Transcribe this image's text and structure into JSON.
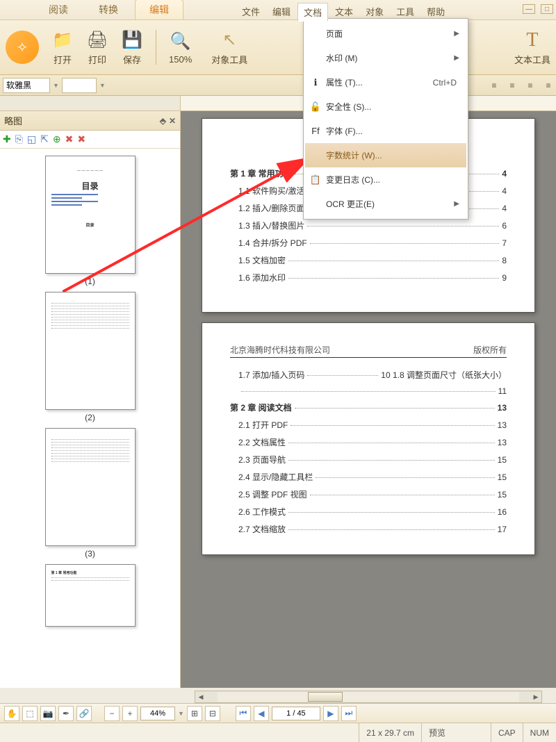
{
  "tabs": [
    "阅读",
    "转换",
    "编辑"
  ],
  "menus": [
    "文件",
    "编辑",
    "文档",
    "文本",
    "对象",
    "工具",
    "帮助"
  ],
  "ribbon": {
    "open": "打开",
    "print": "打印",
    "save": "保存",
    "zoom": "150%",
    "objtool": "对象工具",
    "texttool": "文本工具"
  },
  "dropdown": [
    {
      "label": "页面",
      "arrow": true
    },
    {
      "label": "水印 (M)",
      "arrow": true
    },
    {
      "label": "属性 (T)...",
      "shortcut": "Ctrl+D",
      "icon": "ℹ"
    },
    {
      "label": "安全性 (S)...",
      "icon": "🔓"
    },
    {
      "label": "字体 (F)...",
      "icon": "Ff"
    },
    {
      "label": "字数统计 (W)...",
      "hl": true
    },
    {
      "label": "变更日志 (C)...",
      "icon": "📋"
    },
    {
      "label": "OCR 更正(E)",
      "arrow": true
    }
  ],
  "font": "软雅黑",
  "sidebar": {
    "title": "略图",
    "thumbs": [
      " (1)",
      " (2)",
      " (3)",
      ""
    ]
  },
  "doc": {
    "title": "目录",
    "hdr_left": "北京海腾时代科技有限公司",
    "hdr_right": "版权所有",
    "p1": [
      {
        "ch": true,
        "t": "第 1 章  常用功能",
        "n": "4"
      },
      {
        "t": "1.1 软件购买/激活",
        "n": "4"
      },
      {
        "t": "1.2 插入/删除页面",
        "n": "4"
      },
      {
        "t": "1.3 插入/替换图片",
        "n": "6"
      },
      {
        "t": "1.4 合并/拆分 PDF",
        "n": "7"
      },
      {
        "t": "1.5 文档加密",
        "n": "8"
      },
      {
        "t": "1.6 添加水印",
        "n": "9"
      }
    ],
    "p2": [
      {
        "t": "1.7 添加/插入页码",
        "n": "10 1.8 调整页面尺寸（纸张大小）"
      },
      {
        "t": "",
        "n": "11"
      },
      {
        "ch": true,
        "t": "第 2 章  阅读文档",
        "n": "13"
      },
      {
        "t": "2.1 打开 PDF",
        "n": "13"
      },
      {
        "t": "2.2 文档属性",
        "n": "13"
      },
      {
        "t": "2.3 页面导航",
        "n": "15"
      },
      {
        "t": "2.4 显示/隐藏工具栏",
        "n": "15"
      },
      {
        "t": "2.5 调整 PDF 视图",
        "n": "15"
      },
      {
        "t": "2.6 工作模式",
        "n": "16"
      },
      {
        "t": "2.7 文档缩放",
        "n": "17"
      }
    ]
  },
  "bottom": {
    "zoom": "44%",
    "page": "1 / 45"
  },
  "status": {
    "size": "21 x 29.7  cm",
    "mode": "预览",
    "cap": "CAP",
    "num": "NUM"
  }
}
